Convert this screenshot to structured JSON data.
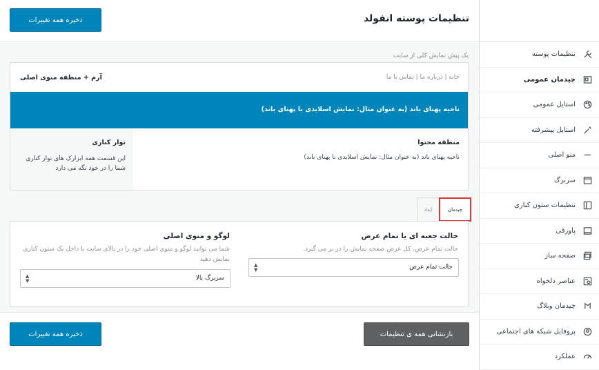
{
  "header": {
    "title": "تنظیمات پوسته انفولد",
    "save_all": "ذخیره همه تغییرات"
  },
  "sidebar": {
    "items": [
      {
        "label": "تنظیمات پوسته",
        "icon": "tools-icon"
      },
      {
        "label": "چیدمان عمومی",
        "icon": "layout-icon",
        "active": true
      },
      {
        "label": "استایل عمومی",
        "icon": "palette-icon"
      },
      {
        "label": "استایل پیشرفته",
        "icon": "magic-wand-icon"
      },
      {
        "label": "منو اصلی",
        "icon": "menu-icon"
      },
      {
        "label": "سربرگ",
        "icon": "header-icon"
      },
      {
        "label": "تنظیمات ستون کناری",
        "icon": "sidebar-icon"
      },
      {
        "label": "پاورقی",
        "icon": "footer-icon"
      },
      {
        "label": "صفحه ساز",
        "icon": "page-builder-icon"
      },
      {
        "label": "عناصر دلخواه",
        "icon": "custom-elements-icon"
      },
      {
        "label": "چیدمان وبلاگ",
        "icon": "blog-layout-icon"
      },
      {
        "label": "پروفایل شبکه های اجتماعی",
        "icon": "social-icon"
      },
      {
        "label": "عملکرد",
        "icon": "performance-icon"
      }
    ]
  },
  "preview": {
    "caption": "یک پیش نمایش کلی از سایت",
    "logo_label": "آرم + منطقه منوی اصلی",
    "top_nav": "خانه | درباره ما | تماس با ما",
    "band_text": "ناحیه پهنای باند (به عنوان مثال: نمایش اسلایدی با پهنای باند)",
    "content_title": "منطقه محتوا",
    "content_text": "ناحیه پهنای باند (به عنوان مثال: نمایش اسلایدی با پهنای باند)",
    "toolbar_title": "نوار کناری",
    "toolbar_text": "این قسمت همه ابزارک های نوار کناری شما را در خود نگه می دارد"
  },
  "tabs": [
    {
      "label": "چیدمان",
      "active": true
    },
    {
      "label": "ابعاد",
      "active": false
    }
  ],
  "fields": {
    "width": {
      "title": "حالت جعبه ای یا تمام عرض",
      "desc": "حالت تمام عرض، کل عرض صفحه نمایش را در بر می گیرد.",
      "value": "حالت تمام عرض"
    },
    "logo_menu": {
      "title": "لوگو و منوی اصلی",
      "desc": "شما می توانید لوگو و منوی اصلی خود را در بالای سایت یا داخل یک ستون کناری نمایش دهید",
      "value": "سربرگ بالا"
    }
  },
  "footer": {
    "reset": "بازنشانی همه ی تنظیمات",
    "save_all": "ذخیره همه تغییرات"
  }
}
